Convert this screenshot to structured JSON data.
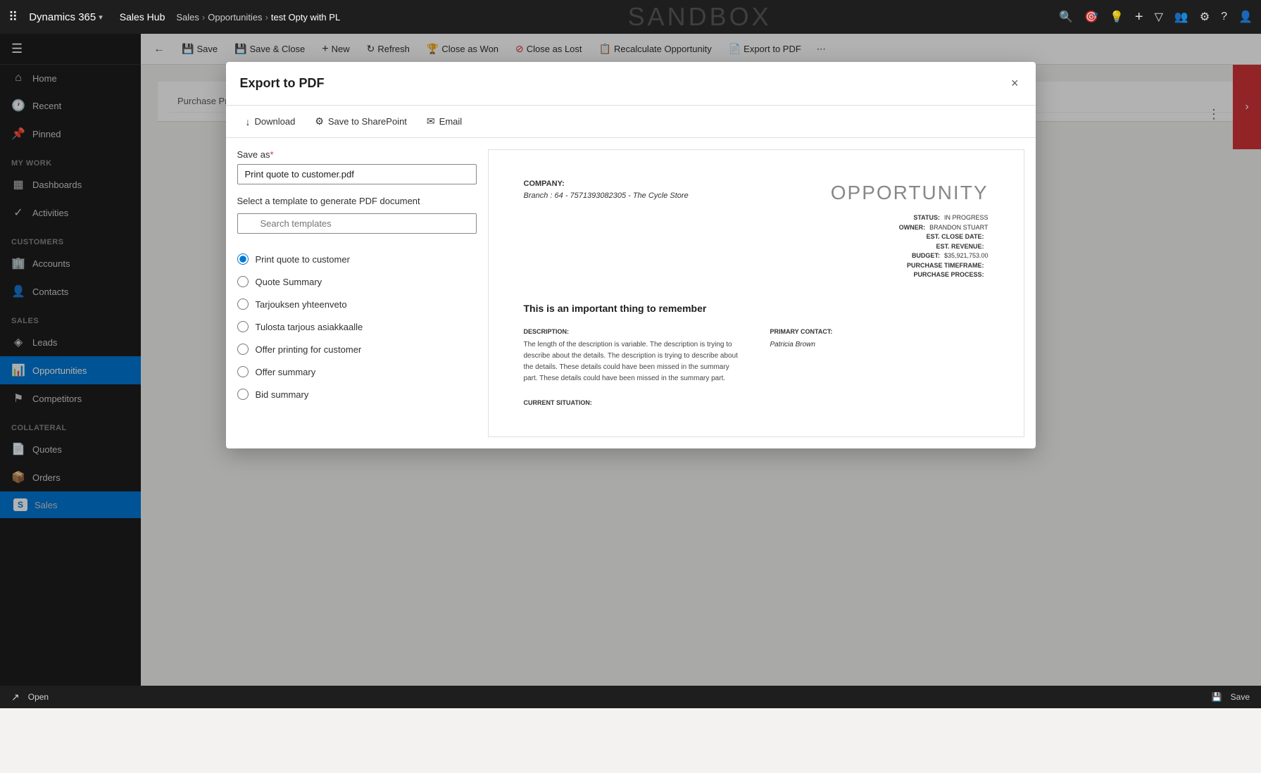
{
  "app": {
    "brand": "Dynamics 365",
    "hub": "Sales Hub",
    "breadcrumb": {
      "sales": "Sales",
      "opportunities": "Opportunities",
      "current": "test Opty with PL"
    },
    "sandbox": "SANDBOX"
  },
  "nav_icons": {
    "search": "🔍",
    "goal": "🎯",
    "lightbulb": "💡",
    "add": "+",
    "filter": "⧫",
    "people": "👥",
    "settings": "⚙",
    "help": "?",
    "user": "👤"
  },
  "command_bar": {
    "buttons": [
      {
        "id": "save",
        "icon": "💾",
        "label": "Save"
      },
      {
        "id": "save-close",
        "icon": "💾",
        "label": "Save & Close"
      },
      {
        "id": "new",
        "icon": "+",
        "label": "New"
      },
      {
        "id": "refresh",
        "icon": "↻",
        "label": "Refresh"
      },
      {
        "id": "close-won",
        "icon": "🏆",
        "label": "Close as Won"
      },
      {
        "id": "close-lost",
        "icon": "⊘",
        "label": "Close as Lost"
      },
      {
        "id": "recalculate",
        "icon": "📋",
        "label": "Recalculate Opportunity"
      },
      {
        "id": "export-pdf",
        "icon": "📄",
        "label": "Export to PDF"
      }
    ]
  },
  "sidebar": {
    "sections": [
      {
        "label": "",
        "items": [
          {
            "id": "home",
            "icon": "⌂",
            "label": "Home"
          },
          {
            "id": "recent",
            "icon": "🕐",
            "label": "Recent"
          },
          {
            "id": "pinned",
            "icon": "📌",
            "label": "Pinned"
          }
        ]
      },
      {
        "label": "My Work",
        "items": [
          {
            "id": "dashboards",
            "icon": "▦",
            "label": "Dashboards"
          },
          {
            "id": "activities",
            "icon": "✓",
            "label": "Activities"
          }
        ]
      },
      {
        "label": "Customers",
        "items": [
          {
            "id": "accounts",
            "icon": "🏢",
            "label": "Accounts"
          },
          {
            "id": "contacts",
            "icon": "👤",
            "label": "Contacts"
          }
        ]
      },
      {
        "label": "Sales",
        "items": [
          {
            "id": "leads",
            "icon": "◈",
            "label": "Leads"
          },
          {
            "id": "opportunities",
            "icon": "📊",
            "label": "Opportunities",
            "active": true
          },
          {
            "id": "competitors",
            "icon": "⚑",
            "label": "Competitors"
          }
        ]
      },
      {
        "label": "Collateral",
        "items": [
          {
            "id": "quotes",
            "icon": "📄",
            "label": "Quotes"
          },
          {
            "id": "orders",
            "icon": "📦",
            "label": "Orders"
          },
          {
            "id": "sales-nav",
            "icon": "S",
            "label": "Sales"
          }
        ]
      }
    ]
  },
  "modal": {
    "title": "Export to PDF",
    "close_label": "×",
    "toolbar": {
      "download": "Download",
      "download_icon": "↓",
      "save_sharepoint": "Save to SharePoint",
      "save_sharepoint_icon": "⚙",
      "email": "Email",
      "email_icon": "✉"
    },
    "save_as": {
      "label": "Save as",
      "required": true,
      "value": "Print quote to customer.pdf",
      "placeholder": "Print quote to customer.pdf"
    },
    "template_section": {
      "label": "Select a template to generate PDF document",
      "search_placeholder": "Search templates",
      "templates": [
        {
          "id": "print-quote",
          "label": "Print quote to customer",
          "selected": true
        },
        {
          "id": "quote-summary",
          "label": "Quote Summary",
          "selected": false
        },
        {
          "id": "tarjouksen",
          "label": "Tarjouksen yhteenveto",
          "selected": false
        },
        {
          "id": "tulosta",
          "label": "Tulosta tarjous asiakkaalle",
          "selected": false
        },
        {
          "id": "offer-printing",
          "label": "Offer printing for customer",
          "selected": false
        },
        {
          "id": "offer-summary",
          "label": "Offer summary",
          "selected": false
        },
        {
          "id": "bid-summary",
          "label": "Bid summary",
          "selected": false
        }
      ]
    },
    "preview": {
      "company_label": "COMPANY:",
      "company_value": "Branch : 64 - 7571393082305 - The Cycle Store",
      "opportunity_title": "OPPORTUNITY",
      "status_label": "STATUS:",
      "status_value": "IN PROGRESS",
      "owner_label": "OWNER:",
      "owner_value": "BRANDON STUART",
      "est_close_label": "EST. CLOSE DATE:",
      "est_close_value": "",
      "est_revenue_label": "EST. REVENUE:",
      "est_revenue_value": "",
      "budget_label": "BUDGET:",
      "budget_value": "$35,921,753.00",
      "purchase_timeframe_label": "PURCHASE TIMEFRAME:",
      "purchase_timeframe_value": "",
      "purchase_process_label": "PURCHASE PROCESS:",
      "purchase_process_value": "",
      "important_text": "This is an important thing to remember",
      "description_label": "DESCRIPTION:",
      "description_text": "The length of the description is variable. The description is trying to describe about the details. The description is trying to describe about the details. These details could have been missed in the summary part. These details could have been missed in the summary part.",
      "primary_contact_label": "PRIMARY CONTACT:",
      "primary_contact_value": "Patricia Brown",
      "current_situation_label": "CURRENT SITUATION:"
    }
  },
  "status_bar": {
    "left_items": [
      "Open",
      "↗"
    ],
    "right_items": [
      "💾 Save"
    ]
  },
  "bg": {
    "purchase_process_label": "Purchase Process",
    "purchase_process_value": "---",
    "open_label": "Open"
  }
}
